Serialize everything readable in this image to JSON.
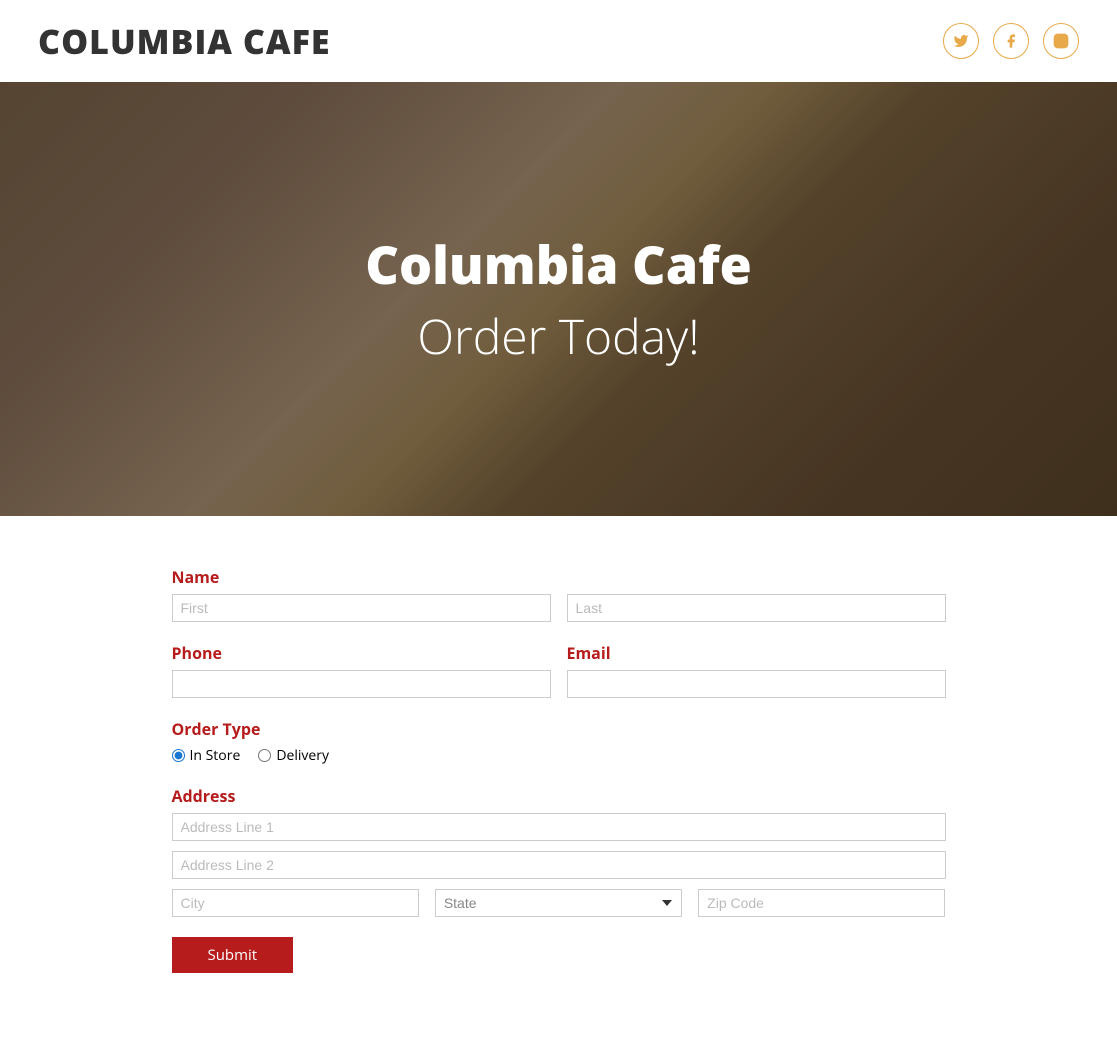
{
  "header": {
    "logo": "COLUMBIA CAFE"
  },
  "hero": {
    "title": "Columbia Cafe",
    "subtitle": "Order Today!"
  },
  "form": {
    "name": {
      "label": "Name",
      "first_placeholder": "First",
      "last_placeholder": "Last"
    },
    "phone": {
      "label": "Phone"
    },
    "email": {
      "label": "Email"
    },
    "order_type": {
      "label": "Order Type",
      "options": {
        "in_store": "In Store",
        "delivery": "Delivery"
      },
      "selected": "in_store"
    },
    "address": {
      "label": "Address",
      "line1_placeholder": "Address Line 1",
      "line2_placeholder": "Address Line 2",
      "city_placeholder": "City",
      "state_placeholder": "State",
      "zip_placeholder": "Zip Code"
    },
    "submit_label": "Submit"
  },
  "colors": {
    "accent": "#b71c1c",
    "social": "#e8a94a"
  }
}
